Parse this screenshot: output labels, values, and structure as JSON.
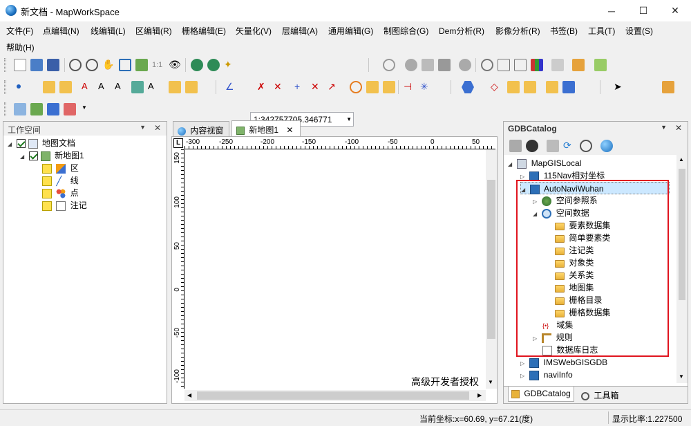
{
  "window": {
    "title": "新文档 - MapWorkSpace",
    "minimize": "─",
    "maximize": "☐",
    "close": "✕"
  },
  "menu": {
    "row1": [
      "文件(F)",
      "点编辑(N)",
      "线编辑(L)",
      "区编辑(R)",
      "栅格编辑(E)",
      "矢量化(V)",
      "层编辑(A)",
      "通用编辑(G)",
      "制图综合(G)",
      "Dem分析(R)",
      "影像分析(R)",
      "书签(B)",
      "工具(T)",
      "设置(S)"
    ],
    "row2": [
      "帮助(H)"
    ]
  },
  "toolbar": {
    "scale_value": "1:342757705.346771",
    "ratio_label": "1:1"
  },
  "workspace": {
    "title": "工作空间",
    "pin": "▼",
    "close": "✕",
    "tree": {
      "root": "地图文档",
      "map": "新地图1",
      "layers": [
        "区",
        "线",
        "点",
        "注记"
      ]
    }
  },
  "doc_tabs": {
    "tab1": "内容视窗",
    "tab2": "新地图1",
    "close": "✕"
  },
  "ruler": {
    "h_ticks": [
      "-300",
      "-250",
      "-200",
      "-150",
      "-100",
      "-50",
      "0",
      "50"
    ],
    "v_ticks": [
      "150",
      "100",
      "50",
      "0",
      "-50",
      "-100"
    ],
    "corner": "L"
  },
  "canvas": {
    "watermark": "高级开发者授权"
  },
  "catalog": {
    "title": "GDBCatalog",
    "pin": "▼",
    "close": "✕",
    "tree": {
      "root": "MapGISLocal",
      "db1": "115Nav相对坐标",
      "db2": "AutoNaviWuhan",
      "srs": "空间参照系",
      "spatial": "空间数据",
      "folders": [
        "要素数据集",
        "简单要素类",
        "注记类",
        "对象类",
        "关系类",
        "地图集",
        "栅格目录",
        "栅格数据集"
      ],
      "domain": "域集",
      "rules": "规则",
      "log": "数据库日志",
      "db3": "IMSWebGISGDB",
      "db4": "naviInfo"
    },
    "bottom_tabs": [
      "GDBCatalog",
      "工具箱"
    ]
  },
  "status": {
    "coords": "当前坐标:x=60.69, y=67.21(度)",
    "ratio": "显示比率:1.227500"
  },
  "colors": {
    "highlight_box": "#e0141e",
    "selection": "#cce8ff"
  }
}
